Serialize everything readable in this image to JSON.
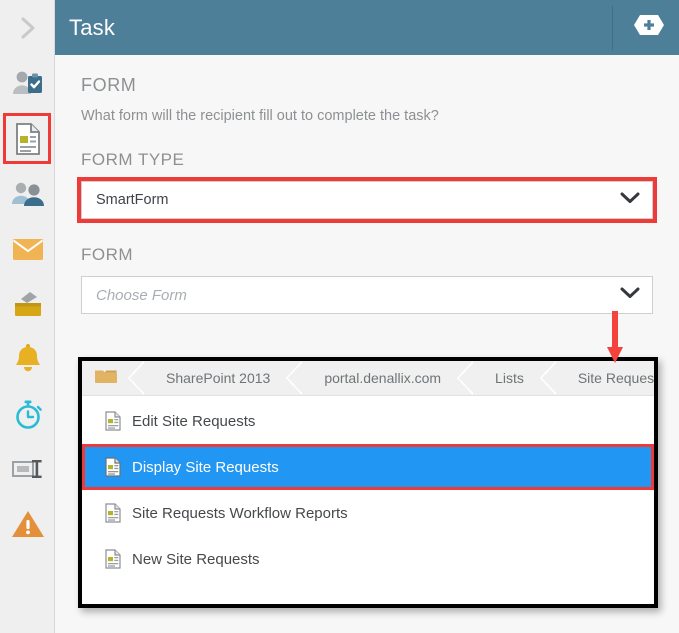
{
  "header": {
    "title": "Task",
    "add_icon": "plus-badge-icon",
    "background_color": "#4d7f99"
  },
  "rail": {
    "expand_icon": "chevron-right-icon",
    "items": [
      {
        "icon": "user-task-icon",
        "name": "task",
        "selected": false
      },
      {
        "icon": "form-document-icon",
        "name": "form",
        "selected": true
      },
      {
        "icon": "users-icon",
        "name": "users",
        "selected": false
      },
      {
        "icon": "envelope-icon",
        "name": "email",
        "selected": false
      },
      {
        "icon": "inbox-tray-icon",
        "name": "inbox",
        "selected": false
      },
      {
        "icon": "bell-icon",
        "name": "notification",
        "selected": false
      },
      {
        "icon": "stopwatch-icon",
        "name": "timer",
        "selected": false
      },
      {
        "icon": "field-placeholder-icon",
        "name": "placeholder",
        "selected": false
      },
      {
        "icon": "warning-triangle-icon",
        "name": "escalation",
        "selected": false
      }
    ]
  },
  "form_section": {
    "title": "FORM",
    "description": "What form will the recipient fill out to complete the task?"
  },
  "form_type": {
    "label": "FORM TYPE",
    "value": "SmartForm",
    "caret_icon": "chevron-down-icon",
    "highlight_color": "#ef3b38"
  },
  "form_field": {
    "label": "FORM",
    "placeholder": "Choose Form",
    "value": "",
    "caret_icon": "chevron-down-icon"
  },
  "annotation": {
    "arrow_icon": "red-down-arrow-icon",
    "arrow_color": "#f4423c"
  },
  "dropdown": {
    "folder_icon": "folder-icon",
    "breadcrumb": [
      "SharePoint 2013",
      "portal.denallix.com",
      "Lists",
      "Site Requests"
    ],
    "items": [
      {
        "label": "Edit Site Requests",
        "icon": "form-item-icon",
        "selected": false
      },
      {
        "label": "Display Site Requests",
        "icon": "form-item-icon",
        "selected": true
      },
      {
        "label": "Site Requests Workflow Reports",
        "icon": "form-item-icon",
        "selected": false
      },
      {
        "label": "New Site Requests",
        "icon": "form-item-icon",
        "selected": false
      }
    ],
    "selection_color": "#2196f3",
    "highlight_color": "#ef3b38"
  }
}
